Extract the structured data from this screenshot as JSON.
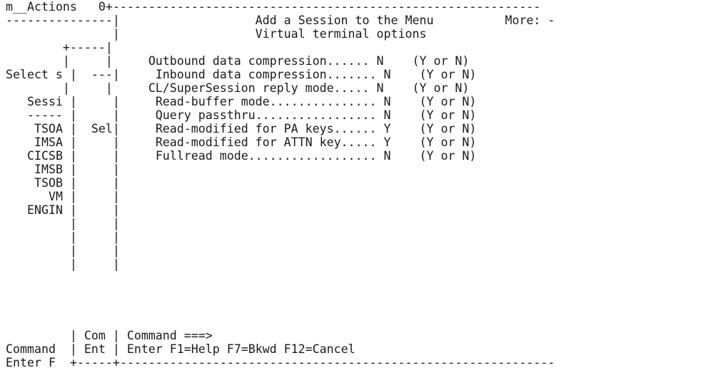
{
  "rows": [
    "m__ Actions   0+------------------------------------------------------------",
    "---------------|                   Add a Session to the Menu          More: -",
    "               |                   Virtual terminal options",
    "        +-----|",
    "        |     |     Outbound data compression...... N    (Y or N)",
    "Select s |  ---|     Inbound data compression....... N    (Y or N)",
    "        |     |     CL/SuperSession reply mode..... N    (Y or N)",
    "   Sessi |     |     Read-buffer mode............... N    (Y or N)",
    "   ----- |     |     Query passthru................. N    (Y or N)",
    "    TSOA |  Sel|     Read-modified for PA keys...... Y    (Y or N)",
    "    IMSA |     |     Read-modified for ATTN key..... Y    (Y or N)",
    "   CICSB |     |     Fullread mode.................. N    (Y or N)",
    "    IMSB |     |",
    "    TSOB |     |",
    "      VM |     |",
    "   ENGIN |     |",
    "         |     |",
    "         |     |",
    "         |     |",
    "         |     |",
    "         | Com | Command ===>",
    "Command  | Ent | Enter F1=Help F7=Bkwd F12=Cancel",
    "Enter F  +-----+-------------------------------------------------------------"
  ],
  "menu": {
    "action_field": "m__",
    "actions": "Actions"
  },
  "panel": {
    "title": "Add a Session to the Menu",
    "subtitle": "Virtual terminal options",
    "more": "More: -",
    "options": [
      {
        "label": "Outbound data compression......",
        "value": "N",
        "hint": "(Y or N)"
      },
      {
        "label": "Inbound data compression.......",
        "value": "N",
        "hint": "(Y or N)"
      },
      {
        "label": "CL/SuperSession reply mode.....",
        "value": "N",
        "hint": "(Y or N)"
      },
      {
        "label": "Read-buffer mode...............",
        "value": "N",
        "hint": "(Y or N)"
      },
      {
        "label": "Query passthru.................",
        "value": "N",
        "hint": "(Y or N)"
      },
      {
        "label": "Read-modified for PA keys......",
        "value": "Y",
        "hint": "(Y or N)"
      },
      {
        "label": "Read-modified for ATTN key.....",
        "value": "Y",
        "hint": "(Y or N)"
      },
      {
        "label": "Fullread mode..................",
        "value": "N",
        "hint": "(Y or N)"
      }
    ],
    "command_prompt": "Command ===>",
    "function_keys": [
      "F1=Help",
      "F7=Bkwd",
      "F12=Cancel"
    ]
  },
  "background": {
    "select_text": "Select s",
    "sessions_header": "Sessi",
    "sessions": [
      "TSOA",
      "IMSA",
      "CICSB",
      "IMSB",
      "TSOB",
      "VM",
      "ENGIN"
    ],
    "command_label": "Command",
    "enter_text": "Enter F"
  }
}
